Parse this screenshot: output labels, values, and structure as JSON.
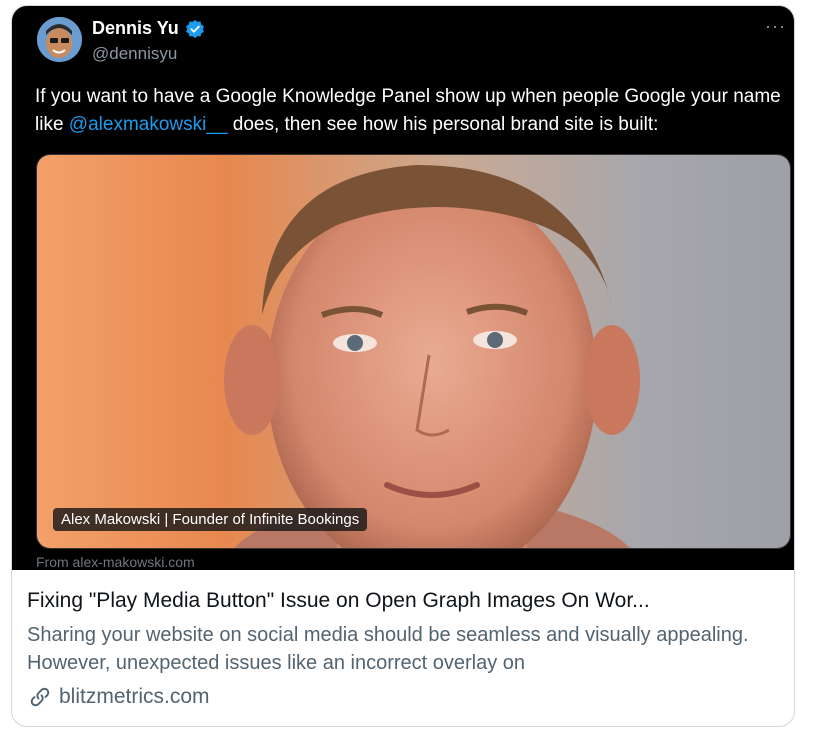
{
  "tweet": {
    "author_name": "Dennis Yu",
    "handle": "@dennisyu",
    "more_label": "···",
    "text_before": "If you want to have a Google Knowledge Panel show up when people Google your name like ",
    "mention": "@alexmakowski__",
    "text_after": " does, then see how his personal brand site is built:"
  },
  "media": {
    "caption": "Alex Makowski | Founder of Infinite Bookings",
    "source": "From alex-makowski.com"
  },
  "link_card": {
    "title": "Fixing \"Play Media Button\" Issue on Open Graph Images On Wor...",
    "description": "Sharing your website on social media should be seamless and visually appealing. However, unexpected issues like an incorrect overlay on",
    "domain": "blitzmetrics.com"
  },
  "colors": {
    "accent": "#1d9bf0",
    "embed_bg": "#000000",
    "secondary_text": "#536471"
  }
}
